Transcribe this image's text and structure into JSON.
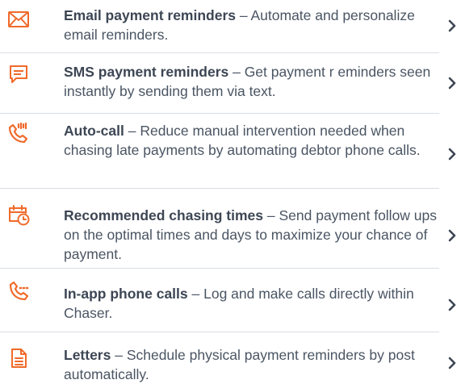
{
  "features": [
    {
      "title": "Email payment reminders",
      "description": " – Automate and personalize email reminders.",
      "icon": "envelope-icon"
    },
    {
      "title": "SMS payment reminders",
      "description": " – Get payment r eminders seen instantly by sending them via text.",
      "icon": "chat-message-icon"
    },
    {
      "title": "Auto-call",
      "description": " – Reduce manual intervention needed when chasing late payments by automating debtor phone calls.",
      "icon": "auto-call-phone-icon"
    },
    {
      "title": "Recommended chasing times",
      "description": " – Send payment follow ups on the optimal times and days to maximize your chance of payment.",
      "icon": "calendar-clock-icon"
    },
    {
      "title": "In-app phone calls",
      "description": " – Log and make calls directly within Chaser.",
      "icon": "phone-call-icon"
    },
    {
      "title": "Letters",
      "description": " – Schedule physical payment reminders by post automatically.",
      "icon": "document-letter-icon"
    }
  ],
  "colors": {
    "accent": "#f06a2a",
    "text": "#4a5563",
    "divider": "#d9dde2"
  }
}
